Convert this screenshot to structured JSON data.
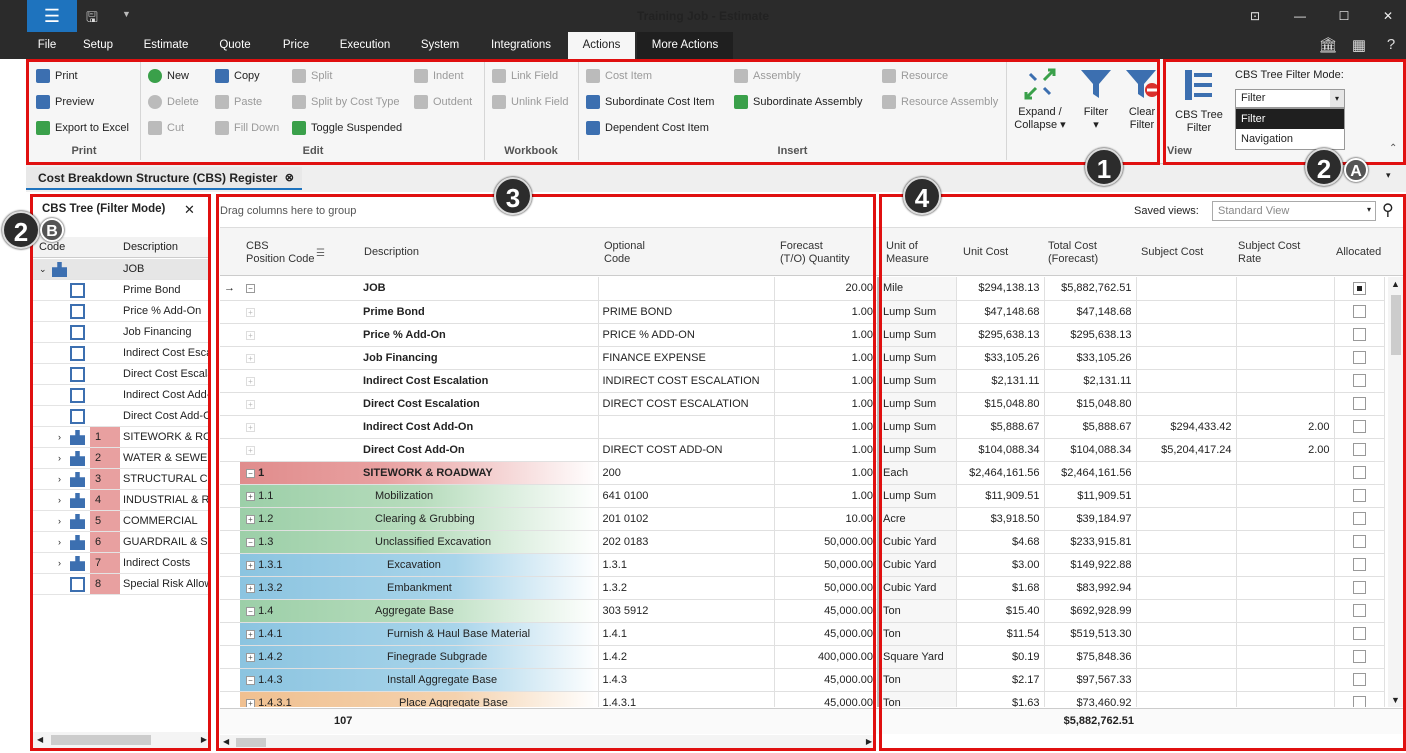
{
  "window": {
    "title": "Training Job - Estimate"
  },
  "menu": [
    "File",
    "Setup",
    "Estimate",
    "Quote",
    "Price",
    "Execution",
    "System",
    "Integrations",
    "Actions",
    "More Actions"
  ],
  "ribbon": {
    "print": {
      "label": "Print",
      "items": [
        "Print",
        "Preview",
        "Export to Excel"
      ]
    },
    "edit": {
      "label": "Edit",
      "col1": [
        "New",
        "Delete",
        "Cut"
      ],
      "col2": [
        "Copy",
        "Paste",
        "Fill Down"
      ],
      "col3": [
        "Split",
        "Split by Cost Type",
        "Toggle Suspended"
      ],
      "col4": [
        "Indent",
        "Outdent"
      ]
    },
    "workbook": {
      "label": "Workbook",
      "items": [
        "Link Field",
        "Unlink Field"
      ]
    },
    "insert": {
      "label": "Insert",
      "col1": [
        "Cost Item",
        "Subordinate Cost Item",
        "Dependent Cost Item"
      ],
      "col2": [
        "Assembly",
        "Subordinate Assembly"
      ],
      "col3": [
        "Resource",
        "Resource Assembly"
      ]
    },
    "expand": {
      "line1": "Expand /",
      "line2": "Collapse"
    },
    "filter": "Filter",
    "clear": {
      "line1": "Clear",
      "line2": "Filter"
    },
    "view": {
      "label": "View",
      "cbs_line1": "CBS Tree",
      "cbs_line2": "Filter",
      "mode_label": "CBS Tree Filter Mode:",
      "mode_value": "Filter",
      "options": [
        "Filter",
        "Navigation"
      ]
    }
  },
  "doc_tab": "Cost Breakdown Structure (CBS) Register",
  "badges": {
    "b1": "1",
    "b2": "2",
    "b2a": "A",
    "b2b": "B",
    "b3": "3",
    "b4": "4",
    "b2left": "2"
  },
  "left": {
    "title": "CBS Tree (Filter Mode)",
    "col_code": "Code",
    "col_desc": "Description",
    "rows": [
      {
        "code": "",
        "desc": "JOB"
      },
      {
        "code": "",
        "desc": "Prime Bond"
      },
      {
        "code": "",
        "desc": "Price % Add-On"
      },
      {
        "code": "",
        "desc": "Job Financing"
      },
      {
        "code": "",
        "desc": "Indirect Cost Escalation"
      },
      {
        "code": "",
        "desc": "Direct Cost Escalation"
      },
      {
        "code": "",
        "desc": "Indirect Cost Add-On"
      },
      {
        "code": "",
        "desc": "Direct Cost Add-On"
      },
      {
        "code": "1",
        "desc": "SITEWORK & ROADWAY"
      },
      {
        "code": "2",
        "desc": "WATER & SEWER"
      },
      {
        "code": "3",
        "desc": "STRUCTURAL CONCRETE"
      },
      {
        "code": "4",
        "desc": "INDUSTRIAL & RESIDENTIAL"
      },
      {
        "code": "5",
        "desc": "COMMERCIAL"
      },
      {
        "code": "6",
        "desc": "GUARDRAIL & SIGNAGE"
      },
      {
        "code": "7",
        "desc": "Indirect Costs"
      },
      {
        "code": "8",
        "desc": "Special Risk Allowance"
      }
    ]
  },
  "grid": {
    "group_hint": "Drag columns here to group",
    "saved_views_label": "Saved views:",
    "saved_view": "Standard View",
    "headers": {
      "cbs": "CBS\nPosition Code",
      "desc": "Description",
      "opt": "Optional\nCode",
      "qty": "Forecast\n(T/O) Quantity",
      "uom": "Unit of\nMeasure",
      "unit": "Unit Cost",
      "total": "Total Cost\n(Forecast)",
      "subj": "Subject Cost",
      "rate": "Subject Cost\nRate",
      "alloc": "Allocated"
    },
    "rows": [
      {
        "code": "",
        "desc": "JOB",
        "opt": "",
        "qty": "20.00",
        "uom": "Mile",
        "unit": "$294,138.13",
        "total": "$5,882,762.51",
        "subj": "",
        "rate": "",
        "alloc": true
      },
      {
        "code": "",
        "desc": "Prime Bond",
        "opt": "PRIME BOND",
        "qty": "1.00",
        "uom": "Lump Sum",
        "unit": "$47,148.68",
        "total": "$47,148.68",
        "subj": "",
        "rate": "",
        "alloc": false
      },
      {
        "code": "",
        "desc": "Price % Add-On",
        "opt": "PRICE % ADD-ON",
        "qty": "1.00",
        "uom": "Lump Sum",
        "unit": "$295,638.13",
        "total": "$295,638.13",
        "subj": "",
        "rate": "",
        "alloc": false
      },
      {
        "code": "",
        "desc": "Job Financing",
        "opt": "FINANCE EXPENSE",
        "qty": "1.00",
        "uom": "Lump Sum",
        "unit": "$33,105.26",
        "total": "$33,105.26",
        "subj": "",
        "rate": "",
        "alloc": false
      },
      {
        "code": "",
        "desc": "Indirect Cost Escalation",
        "opt": "INDIRECT COST ESCALATION",
        "qty": "1.00",
        "uom": "Lump Sum",
        "unit": "$2,131.11",
        "total": "$2,131.11",
        "subj": "",
        "rate": "",
        "alloc": false
      },
      {
        "code": "",
        "desc": "Direct Cost Escalation",
        "opt": "DIRECT COST ESCALATION",
        "qty": "1.00",
        "uom": "Lump Sum",
        "unit": "$15,048.80",
        "total": "$15,048.80",
        "subj": "",
        "rate": "",
        "alloc": false
      },
      {
        "code": "",
        "desc": "Indirect Cost Add-On",
        "opt": "",
        "qty": "1.00",
        "uom": "Lump Sum",
        "unit": "$5,888.67",
        "total": "$5,888.67",
        "subj": "$294,433.42",
        "rate": "2.00",
        "alloc": false
      },
      {
        "code": "",
        "desc": "Direct Cost Add-On",
        "opt": "DIRECT COST ADD-ON",
        "qty": "1.00",
        "uom": "Lump Sum",
        "unit": "$104,088.34",
        "total": "$104,088.34",
        "subj": "$5,204,417.24",
        "rate": "2.00",
        "alloc": false
      },
      {
        "code": "1",
        "desc": "SITEWORK & ROADWAY",
        "opt": "200",
        "qty": "1.00",
        "uom": "Each",
        "unit": "$2,464,161.56",
        "total": "$2,464,161.56",
        "subj": "",
        "rate": "",
        "alloc": false
      },
      {
        "code": "1.1",
        "desc": "Mobilization",
        "opt": "641 0100",
        "qty": "1.00",
        "uom": "Lump Sum",
        "unit": "$11,909.51",
        "total": "$11,909.51",
        "subj": "",
        "rate": "",
        "alloc": false
      },
      {
        "code": "1.2",
        "desc": "Clearing & Grubbing",
        "opt": "201 0102",
        "qty": "10.00",
        "uom": "Acre",
        "unit": "$3,918.50",
        "total": "$39,184.97",
        "subj": "",
        "rate": "",
        "alloc": false
      },
      {
        "code": "1.3",
        "desc": "Unclassified Excavation",
        "opt": "202 0183",
        "qty": "50,000.00",
        "uom": "Cubic Yard",
        "unit": "$4.68",
        "total": "$233,915.81",
        "subj": "",
        "rate": "",
        "alloc": false
      },
      {
        "code": "1.3.1",
        "desc": "Excavation",
        "opt": "1.3.1",
        "qty": "50,000.00",
        "uom": "Cubic Yard",
        "unit": "$3.00",
        "total": "$149,922.88",
        "subj": "",
        "rate": "",
        "alloc": false
      },
      {
        "code": "1.3.2",
        "desc": "Embankment",
        "opt": "1.3.2",
        "qty": "50,000.00",
        "uom": "Cubic Yard",
        "unit": "$1.68",
        "total": "$83,992.94",
        "subj": "",
        "rate": "",
        "alloc": false
      },
      {
        "code": "1.4",
        "desc": "Aggregate Base",
        "opt": "303 5912",
        "qty": "45,000.00",
        "uom": "Ton",
        "unit": "$15.40",
        "total": "$692,928.99",
        "subj": "",
        "rate": "",
        "alloc": false
      },
      {
        "code": "1.4.1",
        "desc": "Furnish & Haul Base Material",
        "opt": "1.4.1",
        "qty": "45,000.00",
        "uom": "Ton",
        "unit": "$11.54",
        "total": "$519,513.30",
        "subj": "",
        "rate": "",
        "alloc": false
      },
      {
        "code": "1.4.2",
        "desc": "Finegrade Subgrade",
        "opt": "1.4.2",
        "qty": "400,000.00",
        "uom": "Square Yard",
        "unit": "$0.19",
        "total": "$75,848.36",
        "subj": "",
        "rate": "",
        "alloc": false
      },
      {
        "code": "1.4.3",
        "desc": "Install Aggregate Base",
        "opt": "1.4.3",
        "qty": "45,000.00",
        "uom": "Ton",
        "unit": "$2.17",
        "total": "$97,567.33",
        "subj": "",
        "rate": "",
        "alloc": false
      },
      {
        "code": "1.4.3.1",
        "desc": "Place Aggregate Base",
        "opt": "1.4.3.1",
        "qty": "45,000.00",
        "uom": "Ton",
        "unit": "$1.63",
        "total": "$73,460.92",
        "subj": "",
        "rate": "",
        "alloc": false
      }
    ],
    "footer_count": "107",
    "footer_total": "$5,882,762.51"
  }
}
